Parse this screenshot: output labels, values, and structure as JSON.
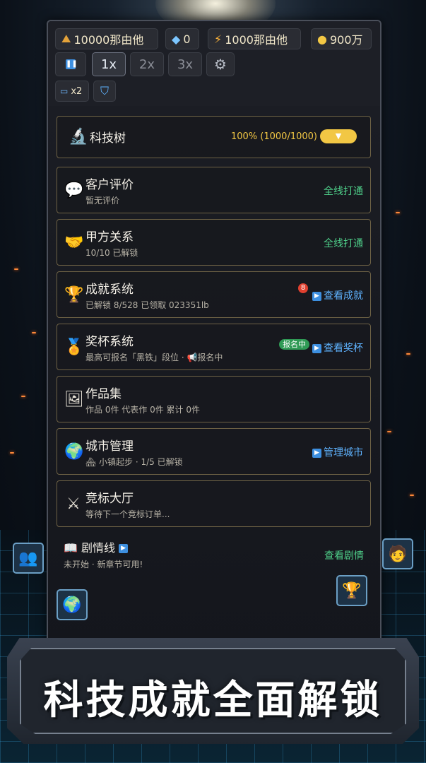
{
  "resources": {
    "gold": "10000那由他",
    "diamond": "0",
    "energy": "1000那由他",
    "coins": "900万"
  },
  "controls": {
    "speed_1x": "1x",
    "speed_2x": "2x",
    "speed_3x": "3x",
    "card_multiplier": "x2"
  },
  "tech_tree": {
    "label": "科技树",
    "progress": "100% (1000/1000)",
    "progress_fraction": 1.0
  },
  "menu": [
    {
      "title": "客户评价",
      "sub": "暂无评价",
      "action": "全线打通",
      "icon": "speech-bubble-icon"
    },
    {
      "title": "甲方关系",
      "sub": "10/10 已解锁",
      "action": "全线打通",
      "icon": "handshake-icon"
    },
    {
      "title": "成就系统",
      "sub": "已解锁 8/528 已领取 023351lb",
      "action": "查看成就",
      "badge": "8",
      "icon": "trophy-icon"
    },
    {
      "title": "奖杯系统",
      "sub": "最高可报名「黑铁」段位 · 📢报名中",
      "action": "查看奖杯",
      "badge": "报名中",
      "icon": "medal-icon"
    },
    {
      "title": "作品集",
      "sub": "作品 0件  代表作 0件  累计 0件",
      "action": "",
      "icon": "picture-icon"
    },
    {
      "title": "城市管理",
      "sub": "🏘 小镇起步 · 1/5 已解锁",
      "action": "管理城市",
      "icon": "globe-icon"
    },
    {
      "title": "竞标大厅",
      "sub": "等待下一个竞标订单...",
      "action": "",
      "icon": "crossed-swords-icon"
    }
  ],
  "story": {
    "title": "剧情线",
    "sub": "未开始 · 新章节可用!",
    "action": "查看剧情"
  },
  "banner": "科技成就全面解锁",
  "colors": {
    "accent_gold": "#f2c744",
    "action_green": "#4fd08a",
    "action_blue": "#5fb3ff",
    "card_border": "#6e6245"
  }
}
